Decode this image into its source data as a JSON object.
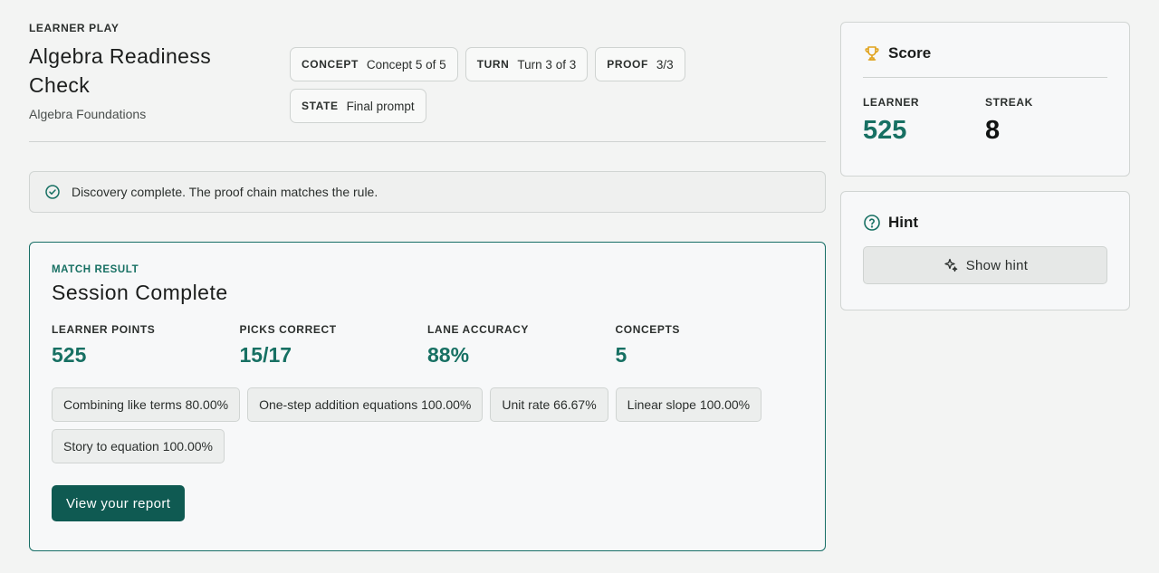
{
  "header": {
    "eyebrow": "LEARNER PLAY",
    "title": "Algebra Readiness Check",
    "subtitle": "Algebra Foundations",
    "chips": [
      {
        "key": "CONCEPT",
        "value": "Concept 5 of 5"
      },
      {
        "key": "TURN",
        "value": "Turn 3 of 3"
      },
      {
        "key": "PROOF",
        "value": "3/3"
      },
      {
        "key": "STATE",
        "value": "Final prompt"
      }
    ]
  },
  "alert": {
    "text": "Discovery complete. The proof chain matches the rule.",
    "icon": "check-circle-icon"
  },
  "result": {
    "eyebrow": "MATCH RESULT",
    "title": "Session Complete",
    "stats": [
      {
        "label": "LEARNER POINTS",
        "value": "525"
      },
      {
        "label": "PICKS CORRECT",
        "value": "15/17"
      },
      {
        "label": "LANE ACCURACY",
        "value": "88%"
      },
      {
        "label": "CONCEPTS",
        "value": "5"
      }
    ],
    "tags": [
      "Combining like terms 80.00%",
      "One-step addition equations 100.00%",
      "Unit rate 66.67%",
      "Linear slope 100.00%",
      "Story to equation 100.00%"
    ],
    "button_label": "View your report"
  },
  "score": {
    "title": "Score",
    "icon": "trophy-icon",
    "learner_label": "LEARNER",
    "learner_value": "525",
    "streak_label": "STREAK",
    "streak_value": "8"
  },
  "hint": {
    "title": "Hint",
    "icon": "help-circle-icon",
    "button_label": "Show hint",
    "button_icon": "sparkles-icon"
  },
  "colors": {
    "accent": "#177063",
    "button": "#0f5a52",
    "trophy": "#e0a21b",
    "background": "#f3f4f3"
  }
}
